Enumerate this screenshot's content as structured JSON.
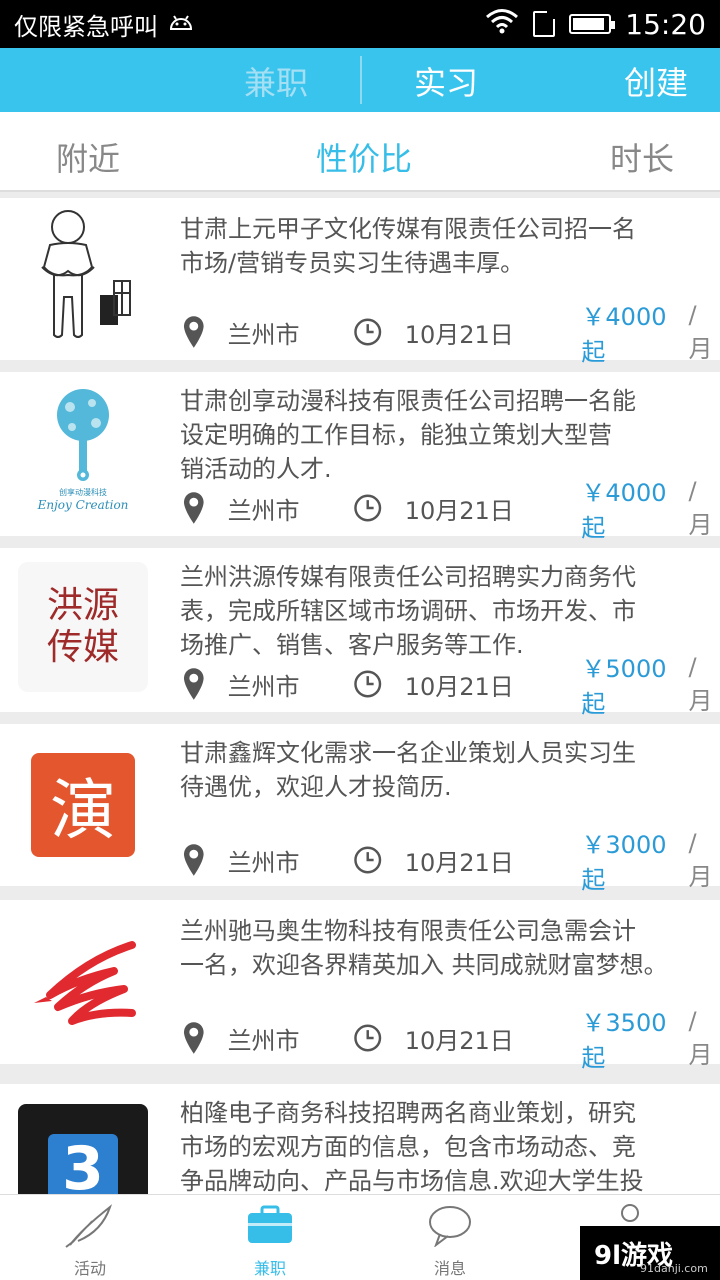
{
  "status_bar": {
    "carrier": "仅限紧急呼叫",
    "time": "15:20",
    "battery_level": 0.9
  },
  "top_nav": {
    "tab_parttime": "兼职",
    "tab_internship": "实习",
    "create": "创建"
  },
  "filters": {
    "nearby": "附近",
    "value": "性价比",
    "duration": "时长"
  },
  "jobs": [
    {
      "line1": "甘肃上元甲子文化传媒有限责任公司招一名",
      "line2": "市场/营销专员实习生待遇丰厚。",
      "line3": "",
      "city": "兰州市",
      "date": "10月21日",
      "price": "￥4000起",
      "unit": "/月"
    },
    {
      "line1": "甘肃创享动漫科技有限责任公司招聘一名能",
      "line2": "设定明确的工作目标，能独立策划大型营",
      "line3": "销活动的人才.",
      "city": "兰州市",
      "date": "10月21日",
      "price": "￥4000起",
      "unit": "/月",
      "logo_caption_cn": "创享动漫科技",
      "logo_caption_en": "Enjoy Creation"
    },
    {
      "line1": "兰州洪源传媒有限责任公司招聘实力商务代",
      "line2": "表，完成所辖区域市场调研、市场开发、市",
      "line3": "场推广、销售、客户服务等工作.",
      "city": "兰州市",
      "date": "10月21日",
      "price": "￥5000起",
      "unit": "/月",
      "logo_text_1": "洪源",
      "logo_text_2": "传媒"
    },
    {
      "line1": "甘肃鑫辉文化需求一名企业策划人员实习生",
      "line2": "待遇优，欢迎人才投简历.",
      "line3": "",
      "city": "兰州市",
      "date": "10月21日",
      "price": "￥3000起",
      "unit": "/月",
      "logo_text": "演"
    },
    {
      "line1": "兰州驰马奥生物科技有限责任公司急需会计",
      "line2": "一名，欢迎各界精英加入 共同成就财富梦想。",
      "line3": "",
      "city": "兰州市",
      "date": "10月21日",
      "price": "￥3500起",
      "unit": "/月"
    },
    {
      "line1": "柏隆电子商务科技招聘两名商业策划，研究",
      "line2": "市场的宏观方面的信息，包含市场动态、竞",
      "line3": "争品牌动向、产品与市场信息.欢迎大学生投",
      "logo_text": "3"
    }
  ],
  "bottom_nav": {
    "activity": "活动",
    "parttime": "兼职",
    "messages": "消息"
  },
  "watermark": {
    "main": "9l游戏",
    "sub": "91danji.com"
  },
  "colors": {
    "accent": "#39c4ee",
    "price": "#2b9bd7",
    "text": "#555555"
  }
}
